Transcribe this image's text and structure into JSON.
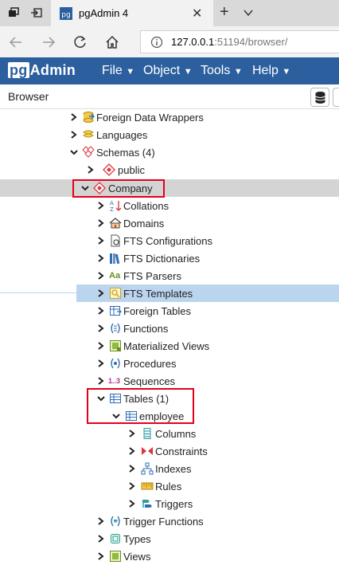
{
  "browser": {
    "tab_title": "pgAdmin 4",
    "url_host": "127.0.0.1",
    "url_rest": ":51194/browser/"
  },
  "app": {
    "logo_pg": "pg",
    "logo_rest": "Admin",
    "menus": [
      "File",
      "Object",
      "Tools",
      "Help"
    ]
  },
  "panel": {
    "title": "Browser"
  },
  "tree": [
    {
      "label": "Foreign Data Wrappers",
      "icon": "foreign-data-wrapper-icon",
      "expanded": false
    },
    {
      "label": "Languages",
      "icon": "languages-icon",
      "expanded": false
    },
    {
      "label": "Schemas (4)",
      "icon": "schemas-icon",
      "expanded": true
    },
    {
      "label": "public",
      "icon": "schema-icon",
      "expanded": false
    },
    {
      "label": "Company",
      "icon": "schema-icon",
      "expanded": true,
      "selected": true
    },
    {
      "label": "Collations",
      "icon": "collations-icon",
      "expanded": false
    },
    {
      "label": "Domains",
      "icon": "domains-icon",
      "expanded": false
    },
    {
      "label": "FTS Configurations",
      "icon": "fts-configurations-icon",
      "expanded": false
    },
    {
      "label": "FTS Dictionaries",
      "icon": "fts-dictionaries-icon",
      "expanded": false
    },
    {
      "label": "FTS Parsers",
      "icon": "fts-parsers-icon",
      "icon_text": "Aa",
      "expanded": false
    },
    {
      "label": "FTS Templates",
      "icon": "fts-templates-icon",
      "expanded": false,
      "hover": true
    },
    {
      "label": "Foreign Tables",
      "icon": "foreign-tables-icon",
      "expanded": false
    },
    {
      "label": "Functions",
      "icon": "functions-icon",
      "expanded": false
    },
    {
      "label": "Materialized Views",
      "icon": "materialized-views-icon",
      "expanded": false
    },
    {
      "label": "Procedures",
      "icon": "procedures-icon",
      "expanded": false
    },
    {
      "label": "Sequences",
      "icon": "sequences-icon",
      "icon_text": "1..3",
      "expanded": false
    },
    {
      "label": "Tables (1)",
      "icon": "tables-icon",
      "expanded": true
    },
    {
      "label": "employee",
      "icon": "table-icon",
      "expanded": true
    },
    {
      "label": "Columns",
      "icon": "columns-icon",
      "expanded": false
    },
    {
      "label": "Constraints",
      "icon": "constraints-icon",
      "expanded": false
    },
    {
      "label": "Indexes",
      "icon": "indexes-icon",
      "expanded": false
    },
    {
      "label": "Rules",
      "icon": "rules-icon",
      "expanded": false
    },
    {
      "label": "Triggers",
      "icon": "triggers-icon",
      "expanded": false
    },
    {
      "label": "Trigger Functions",
      "icon": "trigger-functions-icon",
      "expanded": false
    },
    {
      "label": "Types",
      "icon": "types-icon",
      "expanded": false
    },
    {
      "label": "Views",
      "icon": "views-icon",
      "expanded": false
    }
  ],
  "colors": {
    "header_bg": "#2c5f9e",
    "highlight_box": "#e3001b",
    "hover_row": "#bcd5ef",
    "selected_row": "#d4d4d4"
  }
}
